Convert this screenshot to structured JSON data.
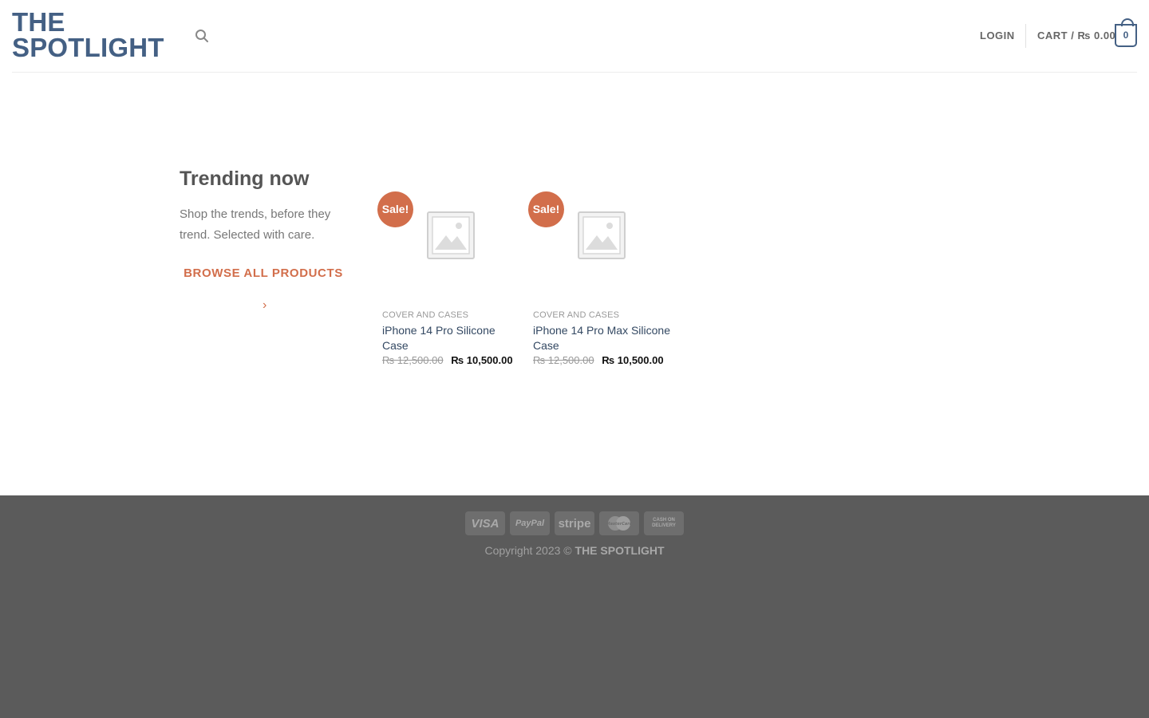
{
  "header": {
    "logo_line1": "THE",
    "logo_line2": "SPOTLIGHT",
    "login": "LOGIN",
    "cart_label": "CART / ₨ 0.00",
    "cart_count": "0"
  },
  "trending": {
    "title": "Trending now",
    "text": "Shop the trends, before they trend. Selected with care.",
    "browse_label": "BROWSE ALL PRODUCTS"
  },
  "products": [
    {
      "sale": "Sale!",
      "category": "COVER AND CASES",
      "name": "iPhone 14 Pro Silicone Case",
      "old_price": "₨ 12,500.00",
      "new_price": "₨ 10,500.00"
    },
    {
      "sale": "Sale!",
      "category": "COVER AND CASES",
      "name": "iPhone 14 Pro Max Silicone Case",
      "old_price": "₨ 12,500.00",
      "new_price": "₨ 10,500.00"
    }
  ],
  "footer": {
    "payments": [
      "VISA",
      "PayPal",
      "stripe",
      "MasterCard",
      "CASH ON DELIVERY"
    ],
    "copyright_prefix": "Copyright 2023 ©",
    "copyright_brand": "THE SPOTLIGHT"
  },
  "colors": {
    "primary": "#446084",
    "accent": "#d26e4b",
    "footer_bg": "#5b5b5b"
  }
}
